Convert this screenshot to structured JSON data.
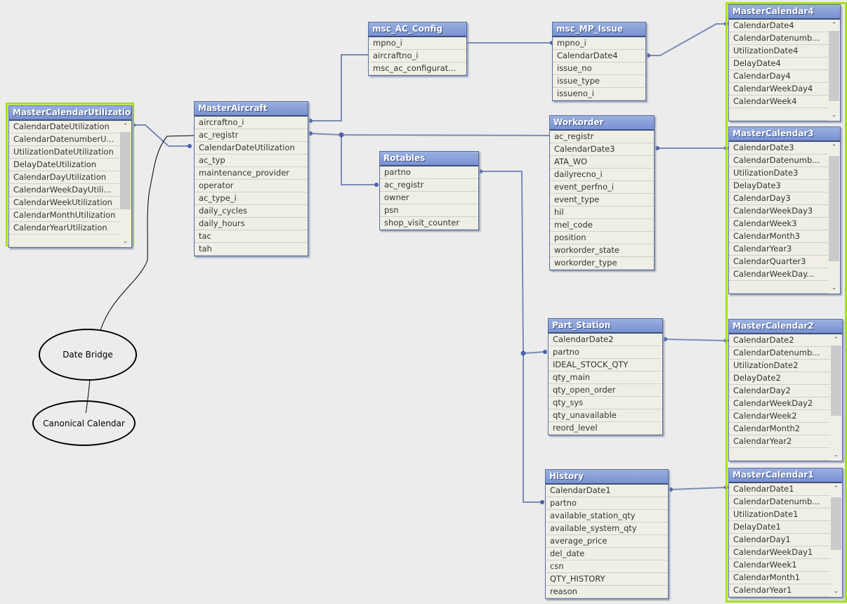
{
  "tables": [
    {
      "name": "MasterCalendarUtilization",
      "fields": [
        "CalendarDateUtilization",
        "CalendarDatenumberU...",
        "UtilizationDateUtilization",
        "DelayDateUtilization",
        "CalendarDayUtilization",
        "CalendarWeekDayUtili...",
        "CalendarWeekUtilization",
        "CalendarMonthUtilization",
        "CalendarYearUtilization",
        ""
      ],
      "scroll": true
    },
    {
      "name": "MasterAircraft",
      "fields": [
        "aircraftno_i",
        "ac_registr",
        "CalendarDateUtilization",
        "ac_typ",
        "maintenance_provider",
        "operator",
        "ac_type_i",
        "daily_cycles",
        "daily_hours",
        "tac",
        "tah"
      ]
    },
    {
      "name": "msc_AC_Config",
      "fields": [
        "mpno_i",
        "aircraftno_i",
        "msc_ac_configurat..."
      ]
    },
    {
      "name": "msc_MP_Issue",
      "fields": [
        "mpno_i",
        "CalendarDate4",
        "issue_no",
        "issue_type",
        "issueno_i"
      ]
    },
    {
      "name": "Workorder",
      "fields": [
        "ac_registr",
        "CalendarDate3",
        "ATA_WO",
        "dailyrecno_i",
        "event_perfno_i",
        "event_type",
        "hil",
        "mel_code",
        "position",
        "workorder_state",
        "workorder_type"
      ]
    },
    {
      "name": "Rotables",
      "fields": [
        "partno",
        "ac_registr",
        "owner",
        "psn",
        "shop_visit_counter"
      ]
    },
    {
      "name": "Part_Station",
      "fields": [
        "CalendarDate2",
        "partno",
        "IDEAL_STOCK_QTY",
        "qty_main",
        "qty_open_order",
        "qty_sys",
        "qty_unavailable",
        "reord_level"
      ]
    },
    {
      "name": "History",
      "fields": [
        "CalendarDate1",
        "partno",
        "available_station_qty",
        "available_system_qty",
        "average_price",
        "del_date",
        "csn",
        "QTY_HISTORY",
        "reason"
      ]
    },
    {
      "name": "MasterCalendar4",
      "fields": [
        "CalendarDate4",
        "CalendarDatenumb...",
        "UtilizationDate4",
        "DelayDate4",
        "CalendarDay4",
        "CalendarWeekDay4",
        "CalendarWeek4",
        ""
      ],
      "scroll": true
    },
    {
      "name": "MasterCalendar3",
      "fields": [
        "CalendarDate3",
        "CalendarDatenumb...",
        "UtilizationDate3",
        "DelayDate3",
        "CalendarDay3",
        "CalendarWeekDay3",
        "CalendarWeek3",
        "CalendarMonth3",
        "CalendarYear3",
        "CalendarQuarter3",
        "CalendarWeekDay...",
        ""
      ],
      "scroll": true
    },
    {
      "name": "MasterCalendar2",
      "fields": [
        "CalendarDate2",
        "CalendarDatenumb...",
        "UtilizationDate2",
        "DelayDate2",
        "CalendarDay2",
        "CalendarWeekDay2",
        "CalendarWeek2",
        "CalendarMonth2",
        "CalendarYear2",
        ""
      ],
      "scroll": true
    },
    {
      "name": "MasterCalendar1",
      "fields": [
        "CalendarDate1",
        "CalendarDatenumb...",
        "UtilizationDate1",
        "DelayDate1",
        "CalendarDay1",
        "CalendarWeekDay1",
        "CalendarWeek1",
        "CalendarMonth1",
        "CalendarYear1"
      ],
      "scroll": true
    }
  ],
  "annotations": {
    "date_bridge": "Date Bridge",
    "canonical_calendar": "Canonical Calendar"
  },
  "colors": {
    "highlight": "#a6e01c",
    "header": "#7791d2",
    "link": "#7b8bb5"
  }
}
